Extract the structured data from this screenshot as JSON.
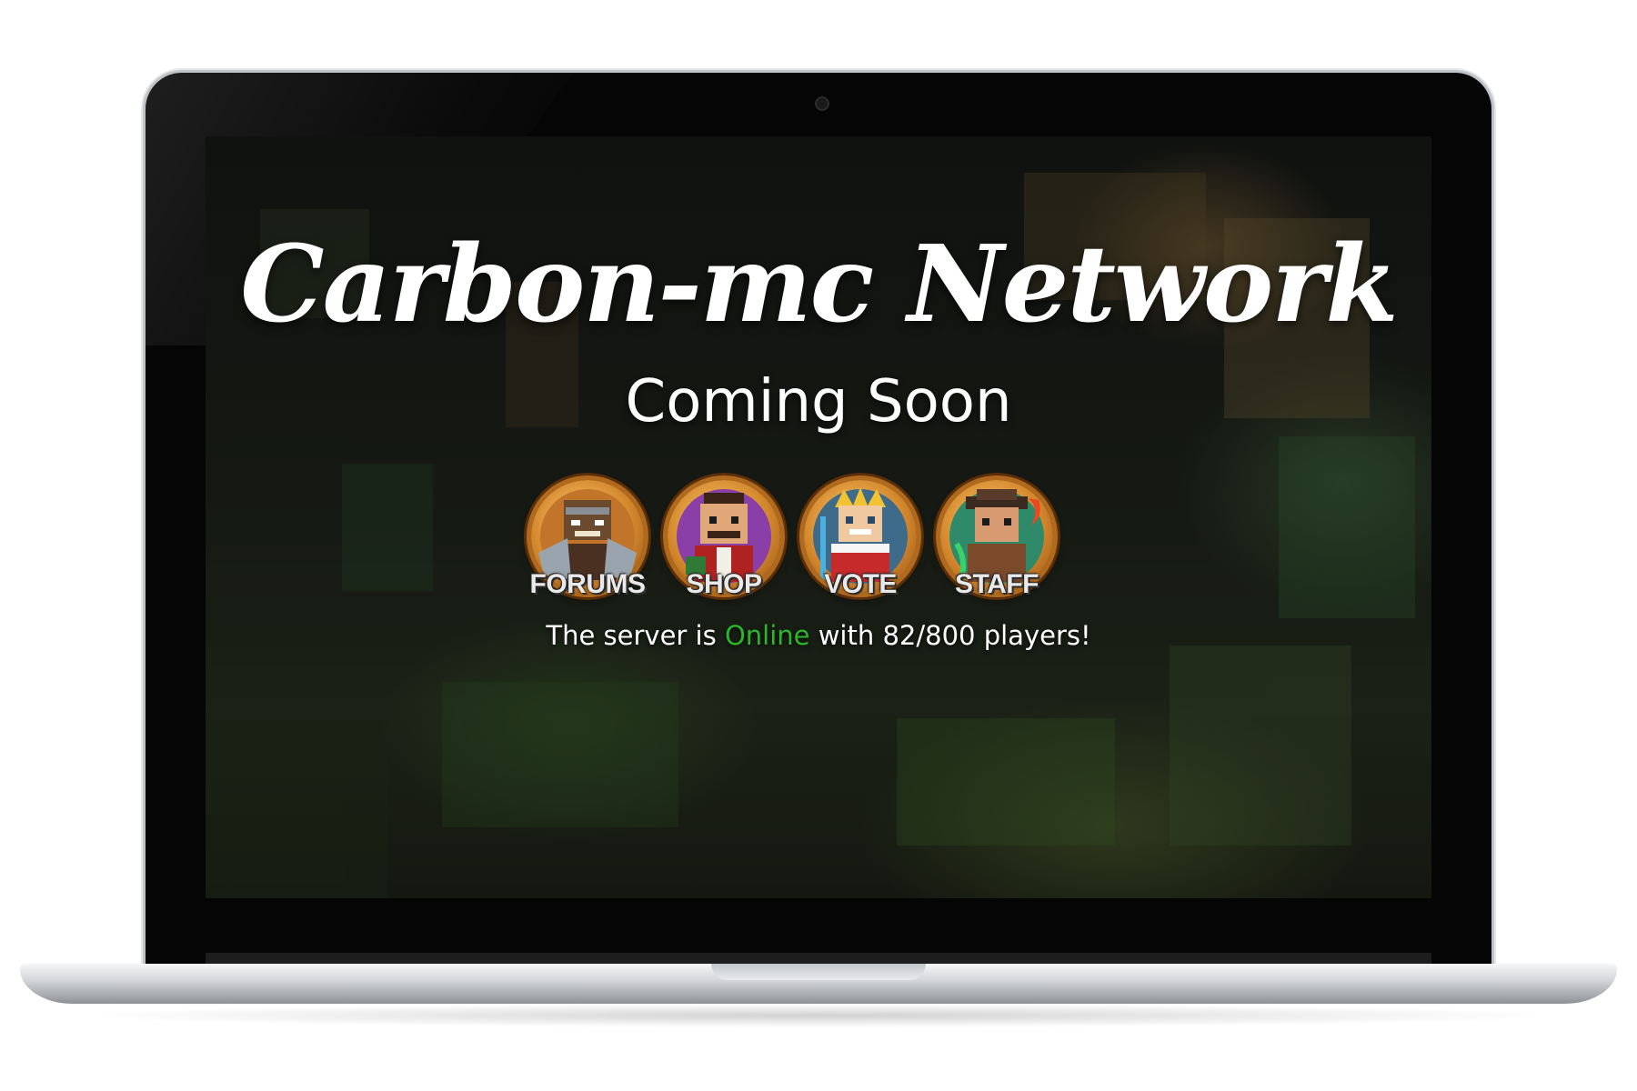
{
  "page": {
    "title": "Carbon-mc Network",
    "subtitle": "Coming Soon"
  },
  "nav": {
    "items": [
      {
        "label": "FORUMS",
        "icon": "warrior-avatar-icon"
      },
      {
        "label": "SHOP",
        "icon": "merchant-avatar-icon"
      },
      {
        "label": "VOTE",
        "icon": "king-avatar-icon"
      },
      {
        "label": "STAFF",
        "icon": "wizard-avatar-icon"
      }
    ]
  },
  "status": {
    "prefix": "The server is",
    "state": "Online",
    "middle": "with",
    "players": "82/800",
    "suffix": "players!"
  },
  "colors": {
    "online": "#2bb52b",
    "medal_gold": "#d4882d",
    "text": "#ffffff"
  }
}
